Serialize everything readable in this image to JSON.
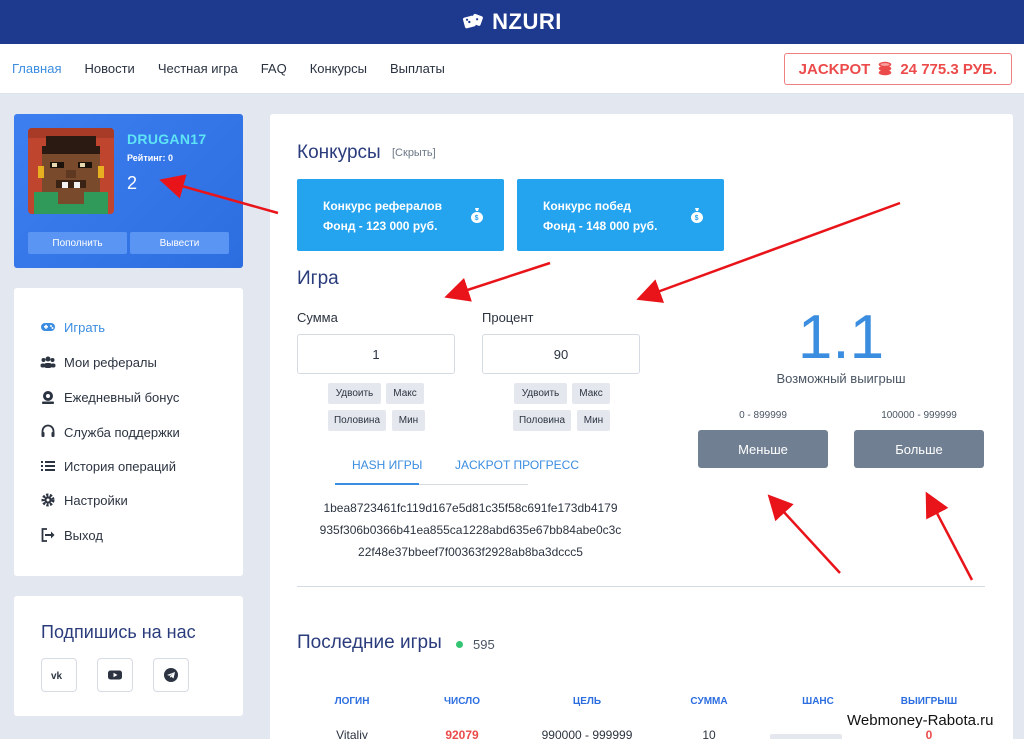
{
  "header": {
    "brand": "NZURI"
  },
  "nav": {
    "items": [
      {
        "label": "Главная",
        "active": true
      },
      {
        "label": "Новости",
        "active": false
      },
      {
        "label": "Честная игра",
        "active": false
      },
      {
        "label": "FAQ",
        "active": false
      },
      {
        "label": "Конкурсы",
        "active": false
      },
      {
        "label": "Выплаты",
        "active": false
      }
    ],
    "jackpot": {
      "label": "JACKPOT",
      "amount": "24 775.3 РУБ."
    }
  },
  "profile": {
    "username": "DRUGAN17",
    "rating": "Рейтинг: 0",
    "balance": "2",
    "deposit_label": "Пополнить",
    "withdraw_label": "Вывести"
  },
  "menu": {
    "items": [
      {
        "label": "Играть",
        "icon": "gamepad-icon",
        "active": true
      },
      {
        "label": "Мои рефералы",
        "icon": "users-icon",
        "active": false
      },
      {
        "label": "Ежедневный бонус",
        "icon": "bonus-icon",
        "active": false
      },
      {
        "label": "Служба поддержки",
        "icon": "headset-icon",
        "active": false
      },
      {
        "label": "История операций",
        "icon": "list-icon",
        "active": false
      },
      {
        "label": "Настройки",
        "icon": "gear-icon",
        "active": false
      },
      {
        "label": "Выход",
        "icon": "logout-icon",
        "active": false
      }
    ]
  },
  "social": {
    "title": "Подпишись на нас",
    "links": [
      "vk-icon",
      "youtube-icon",
      "telegram-icon"
    ]
  },
  "contests": {
    "title": "Конкурсы",
    "hide_label": "[Скрыть]",
    "tiles": [
      {
        "line1": "Конкурс рефералов",
        "line2": "Фонд - 123 000 руб."
      },
      {
        "line1": "Конкурс побед",
        "line2": "Фонд - 148 000 руб."
      }
    ]
  },
  "game": {
    "title": "Игра",
    "sum": {
      "label": "Сумма",
      "value": "1",
      "chips": [
        "Удвоить",
        "Макс",
        "Половина",
        "Мин"
      ]
    },
    "percent": {
      "label": "Процент",
      "value": "90",
      "chips": [
        "Удвоить",
        "Макс",
        "Половина",
        "Мин"
      ]
    },
    "tabs": [
      "HASH ИГРЫ",
      "JACKPOT ПРОГРЕСС"
    ],
    "hash_lines": [
      "1bea8723461fc119d167e5d81c35f58c691fe173db4179",
      "935f306b0366b41ea855ca1228abd635e67bb84abe0c3c",
      "22f48e37bbeef7f00363f2928ab8ba3dccc5"
    ],
    "multiplier": "1.1",
    "possible_win_label": "Возможный выигрыш",
    "less": {
      "range": "0 - 899999",
      "label": "Меньше"
    },
    "more": {
      "range": "100000 - 999999",
      "label": "Больше"
    }
  },
  "recent": {
    "title": "Последние игры",
    "count": "595",
    "columns": [
      "ЛОГИН",
      "ЧИСЛО",
      "ЦЕЛЬ",
      "СУММА",
      "ШАНС",
      "ВЫИГРЫШ"
    ],
    "rows": [
      {
        "login": "Vitaliy",
        "number": "92079",
        "target": "990000 - 999999",
        "sum": "10",
        "chance": "",
        "win": "0"
      }
    ]
  },
  "watermark": "Webmoney-Rabota.ru",
  "colors": {
    "header": "#1e3a8f",
    "accent": "#3b8de0",
    "tile": "#24a3ef",
    "jackpot": "#ec4b4b",
    "annotation_arrow": "#e8141a"
  }
}
